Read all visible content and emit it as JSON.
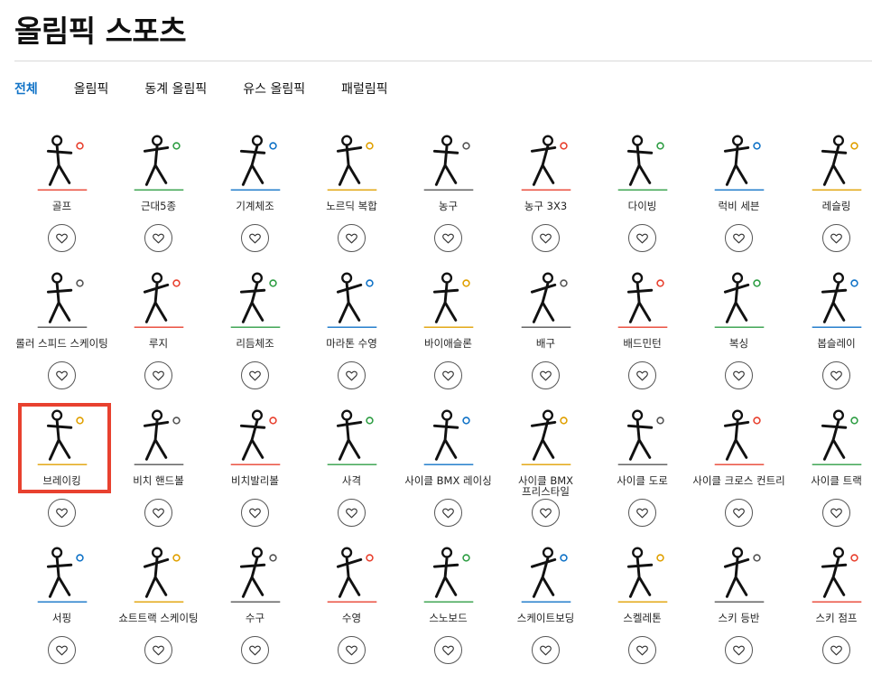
{
  "page": {
    "title": "올림픽 스포츠"
  },
  "tabs": [
    {
      "label": "전체",
      "active": true
    },
    {
      "label": "올림픽",
      "active": false
    },
    {
      "label": "동계 올림픽",
      "active": false
    },
    {
      "label": "유스 올림픽",
      "active": false
    },
    {
      "label": "패럴림픽",
      "active": false
    }
  ],
  "sports": [
    [
      {
        "label": "골프",
        "icon": "golf-icon"
      },
      {
        "label": "근대5종",
        "icon": "modern-pentathlon-icon"
      },
      {
        "label": "기계체조",
        "icon": "artistic-gymnastics-icon"
      },
      {
        "label": "노르딕 복합",
        "icon": "nordic-combined-icon"
      },
      {
        "label": "농구",
        "icon": "basketball-icon"
      },
      {
        "label": "농구 3X3",
        "icon": "basketball-3x3-icon"
      },
      {
        "label": "다이빙",
        "icon": "diving-icon"
      },
      {
        "label": "럭비 세븐",
        "icon": "rugby-sevens-icon"
      },
      {
        "label": "레슬링",
        "icon": "wrestling-icon"
      }
    ],
    [
      {
        "label": "롤러 스피드 스케이팅",
        "icon": "roller-speed-skating-icon"
      },
      {
        "label": "루지",
        "icon": "luge-icon"
      },
      {
        "label": "리듬체조",
        "icon": "rhythmic-gymnastics-icon"
      },
      {
        "label": "마라톤 수영",
        "icon": "marathon-swimming-icon"
      },
      {
        "label": "바이애슬론",
        "icon": "biathlon-icon"
      },
      {
        "label": "배구",
        "icon": "volleyball-icon"
      },
      {
        "label": "배드민턴",
        "icon": "badminton-icon"
      },
      {
        "label": "복싱",
        "icon": "boxing-icon"
      },
      {
        "label": "봅슬레이",
        "icon": "bobsleigh-icon"
      }
    ],
    [
      {
        "label": "브레이킹",
        "icon": "breaking-icon"
      },
      {
        "label": "비치 핸드볼",
        "icon": "beach-handball-icon"
      },
      {
        "label": "비치발리볼",
        "icon": "beach-volleyball-icon"
      },
      {
        "label": "사격",
        "icon": "shooting-icon"
      },
      {
        "label": "사이클 BMX 레이싱",
        "icon": "cycling-bmx-racing-icon"
      },
      {
        "label": "사이클 BMX 프리스타일",
        "icon": "cycling-bmx-freestyle-icon"
      },
      {
        "label": "사이클 도로",
        "icon": "cycling-road-icon"
      },
      {
        "label": "사이클 크로스 컨트리",
        "icon": "cycling-cross-country-icon"
      },
      {
        "label": "사이클 트랙",
        "icon": "cycling-track-icon"
      }
    ],
    [
      {
        "label": "서핑",
        "icon": "surfing-icon"
      },
      {
        "label": "쇼트트랙 스케이팅",
        "icon": "short-track-skating-icon"
      },
      {
        "label": "수구",
        "icon": "water-polo-icon"
      },
      {
        "label": "수영",
        "icon": "swimming-icon"
      },
      {
        "label": "스노보드",
        "icon": "snowboard-icon"
      },
      {
        "label": "스케이트보딩",
        "icon": "skateboarding-icon"
      },
      {
        "label": "스켈레톤",
        "icon": "skeleton-icon"
      },
      {
        "label": "스키 등반",
        "icon": "ski-mountaineering-icon"
      },
      {
        "label": "스키 점프",
        "icon": "ski-jumping-icon"
      }
    ]
  ],
  "favorite_icon": "heart-icon",
  "colors": {
    "active_tab": "#1173c7",
    "highlight": "#e8412f"
  }
}
